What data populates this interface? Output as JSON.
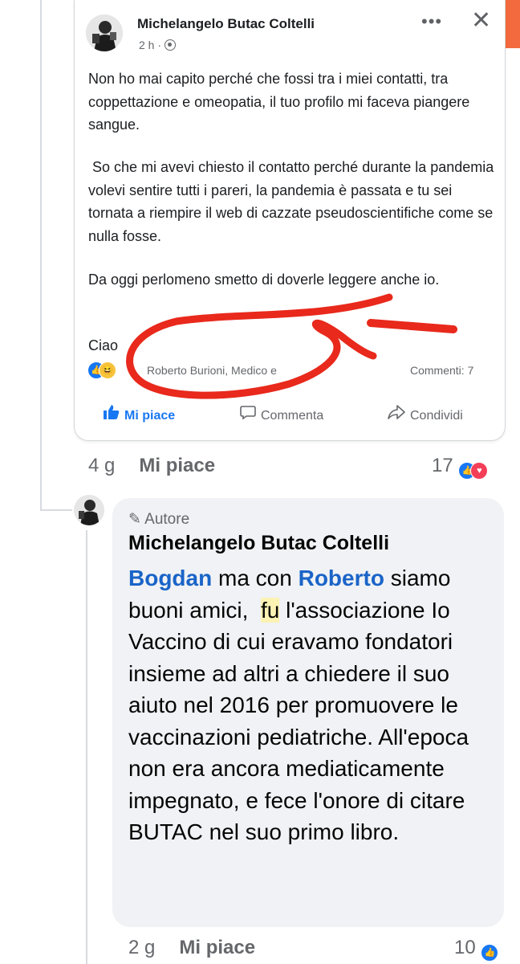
{
  "post": {
    "author": "Michelangelo Butac Coltelli",
    "time": "2 h ·",
    "paragraphs": [
      "Non ho mai capito perché che fossi tra i miei contatti, tra coppettazione e omeopatia, il tuo profilo mi faceva piangere sangue.",
      " So che mi avevi chiesto il contatto perché durante la pandemia volevi sentire tutti i pareri, la pandemia è passata e tu sei tornata a riempire il web di cazzate pseudoscientifiche come se nulla fosse.",
      "Da oggi perlomeno smetto di doverle leggere anche io.",
      "Ciao"
    ],
    "reaction_names": "Roberto Burioni, Medico e",
    "comments_count": "Commenti: 7",
    "actions": {
      "like": "Mi piace",
      "comment": "Commenta",
      "share": "Condividi"
    }
  },
  "comment1_meta": {
    "age": "4 g",
    "like_label": "Mi piace",
    "reaction_count": "17"
  },
  "comment2": {
    "badge": "Autore",
    "author": "Michelangelo Butac Coltelli",
    "mention1": "Bogdan",
    "text_a": " ma con ",
    "mention2": "Roberto",
    "text_b": " siamo buoni amici,  ",
    "highlight": "fu",
    "text_c": " l'associazione Io Vaccino di cui eravamo fondatori insieme ad altri a chiedere il suo aiuto nel 2016 per promuovere le vaccinazioni pediatriche. All'epoca non era ancora mediaticamente impegnato, e fece l'onore di citare BUTAC nel suo primo libro.",
    "age": "2 g",
    "like_label": "Mi piace",
    "reaction_count": "10"
  },
  "colors": {
    "accent": "#1877f2",
    "mention": "#1a64c8",
    "scribble": "#e8291c"
  },
  "icons": [
    "globe-icon",
    "more-dots-icon",
    "close-icon",
    "like-reaction-icon",
    "haha-reaction-icon",
    "love-reaction-icon",
    "thumbs-up-icon",
    "comment-icon",
    "share-icon",
    "pencil-icon"
  ]
}
